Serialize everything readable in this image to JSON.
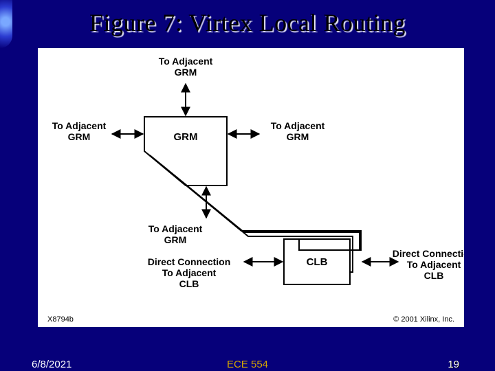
{
  "title": "Figure 7: Virtex Local Routing",
  "footer": {
    "date": "6/8/2021",
    "course": "ECE 554",
    "page": 19
  },
  "diagram": {
    "boxes": {
      "grm": "GRM",
      "clb": "CLB"
    },
    "labels": {
      "adjacent_grm_top": "To Adjacent\nGRM",
      "adjacent_grm_left": "To Adjacent\nGRM",
      "adjacent_grm_right": "To Adjacent\nGRM",
      "adjacent_grm_bottom": "To Adjacent\nGRM",
      "direct_left": "Direct Connection\nTo Adjacent\nCLB",
      "direct_right": "Direct Connection\nTo Adjacent\nCLB",
      "figure_id": "X8794b",
      "copyright": "© 2001 Xilinx, Inc."
    }
  },
  "chart_data": {
    "type": "diagram",
    "title": "Virtex Local Routing",
    "nodes": [
      {
        "id": "grm",
        "label": "GRM",
        "shape": "trapezoid"
      },
      {
        "id": "clb",
        "label": "CLB",
        "shape": "rect"
      },
      {
        "id": "adj_grm_top",
        "label": "To Adjacent GRM",
        "shape": "text"
      },
      {
        "id": "adj_grm_left",
        "label": "To Adjacent GRM",
        "shape": "text"
      },
      {
        "id": "adj_grm_right",
        "label": "To Adjacent GRM",
        "shape": "text"
      },
      {
        "id": "adj_grm_bottom",
        "label": "To Adjacent GRM",
        "shape": "text"
      },
      {
        "id": "adj_clb_left",
        "label": "Direct Connection To Adjacent CLB",
        "shape": "text"
      },
      {
        "id": "adj_clb_right",
        "label": "Direct Connection To Adjacent CLB",
        "shape": "text"
      }
    ],
    "edges": [
      {
        "from": "grm",
        "to": "adj_grm_top",
        "style": "bidir"
      },
      {
        "from": "grm",
        "to": "adj_grm_left",
        "style": "bidir"
      },
      {
        "from": "grm",
        "to": "adj_grm_right",
        "style": "bidir"
      },
      {
        "from": "grm",
        "to": "adj_grm_bottom",
        "style": "bidir"
      },
      {
        "from": "grm",
        "to": "clb",
        "style": "bus_pair"
      },
      {
        "from": "clb",
        "to": "adj_clb_left",
        "style": "bidir"
      },
      {
        "from": "clb",
        "to": "adj_clb_right",
        "style": "bidir"
      }
    ],
    "annotations": [
      {
        "text": "X8794b",
        "position": "bottom-left"
      },
      {
        "text": "© 2001 Xilinx, Inc.",
        "position": "bottom-right"
      }
    ]
  }
}
